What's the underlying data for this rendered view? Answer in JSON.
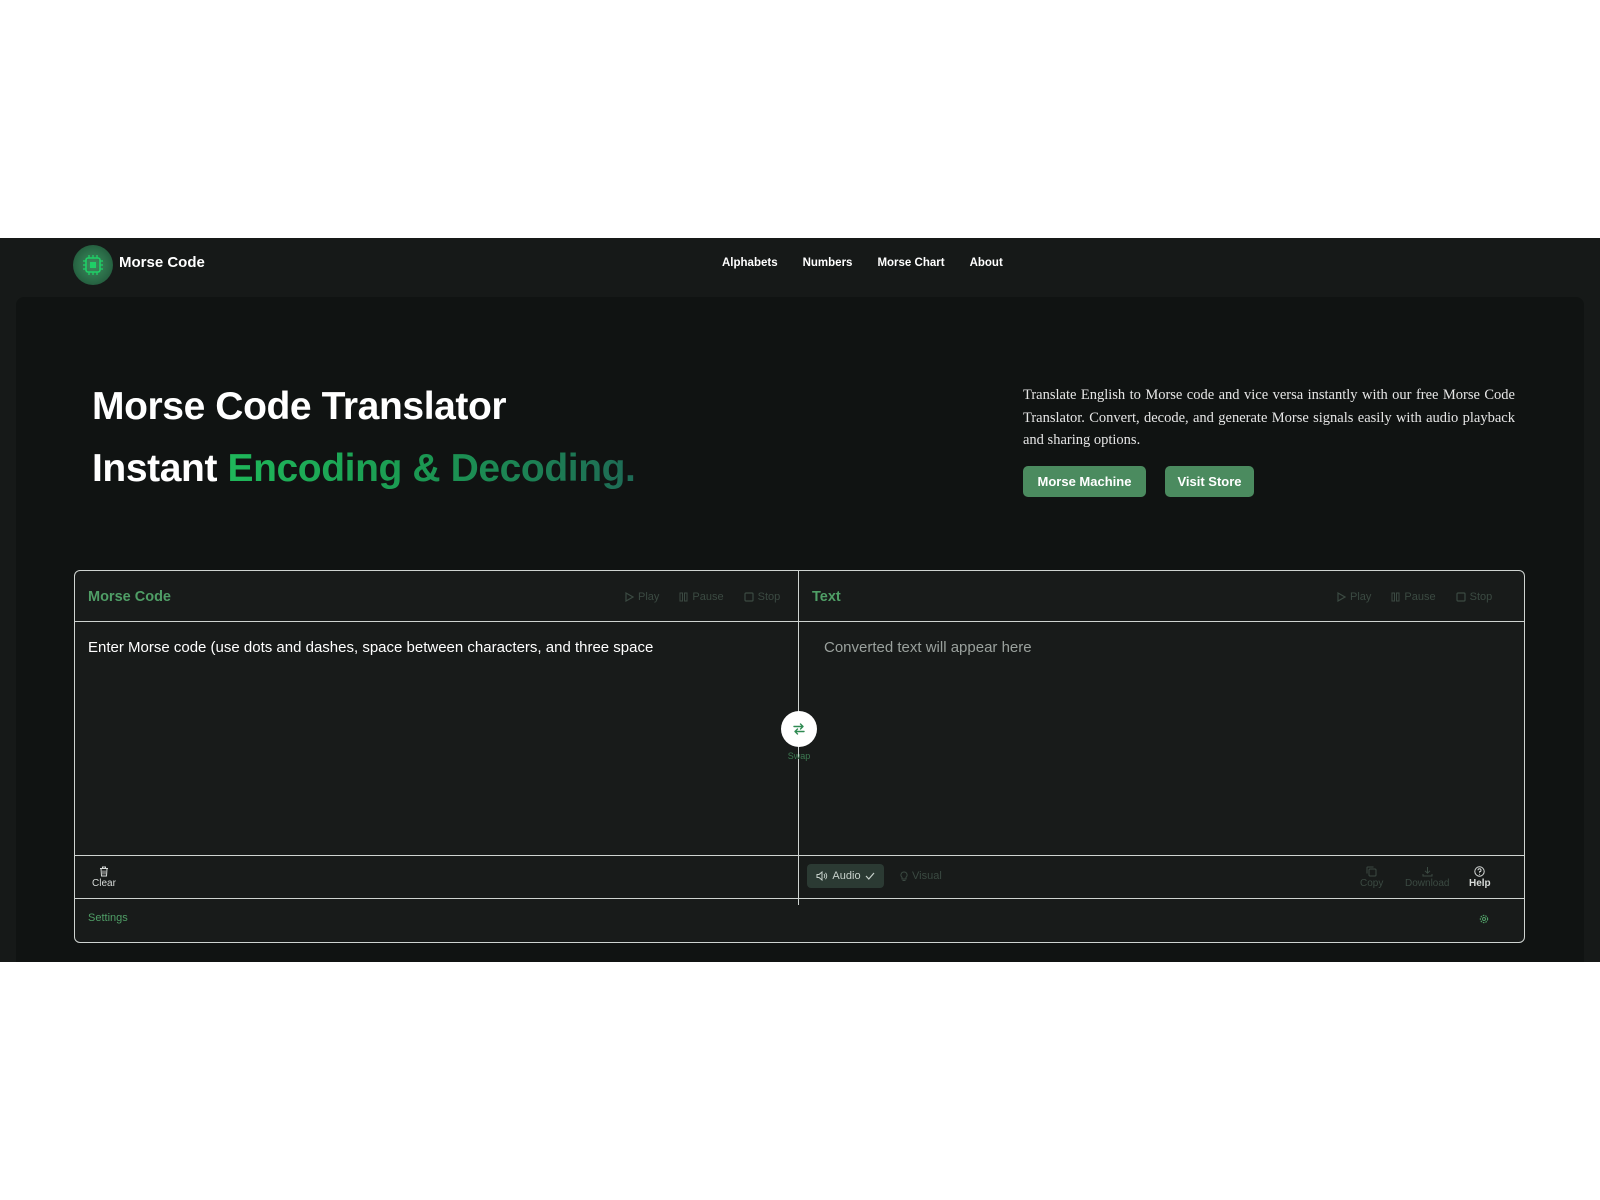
{
  "nav": {
    "brand": "Morse Code",
    "links": [
      "Alphabets",
      "Numbers",
      "Morse Chart",
      "About"
    ]
  },
  "hero": {
    "title_line1": "Morse Code Translator",
    "title_line2_plain": "Instant",
    "title_line2_accent": "Encoding & Decoding.",
    "description": "Translate English to Morse code and vice versa instantly with our free Morse Code Translator. Convert, decode, and generate Morse signals easily with audio playback and sharing options.",
    "buttons": {
      "machine": "Morse Machine",
      "store": "Visit Store"
    }
  },
  "translator": {
    "left": {
      "title": "Morse Code",
      "placeholder": "Enter Morse code (use dots and dashes, space between characters, and three space",
      "controls": {
        "play": "Play",
        "pause": "Pause",
        "stop": "Stop"
      },
      "clear": "Clear"
    },
    "right": {
      "title": "Text",
      "placeholder": "Converted text will appear here",
      "controls": {
        "play": "Play",
        "pause": "Pause",
        "stop": "Stop"
      },
      "modes": {
        "audio": "Audio",
        "visual": "Visual"
      },
      "actions": {
        "copy": "Copy",
        "download": "Download",
        "help": "Help"
      }
    },
    "swap_label": "Swap",
    "settings_label": "Settings"
  },
  "colors": {
    "accent_green": "#4f9e66",
    "button_green": "#4b8b5f",
    "background": "#101312"
  }
}
